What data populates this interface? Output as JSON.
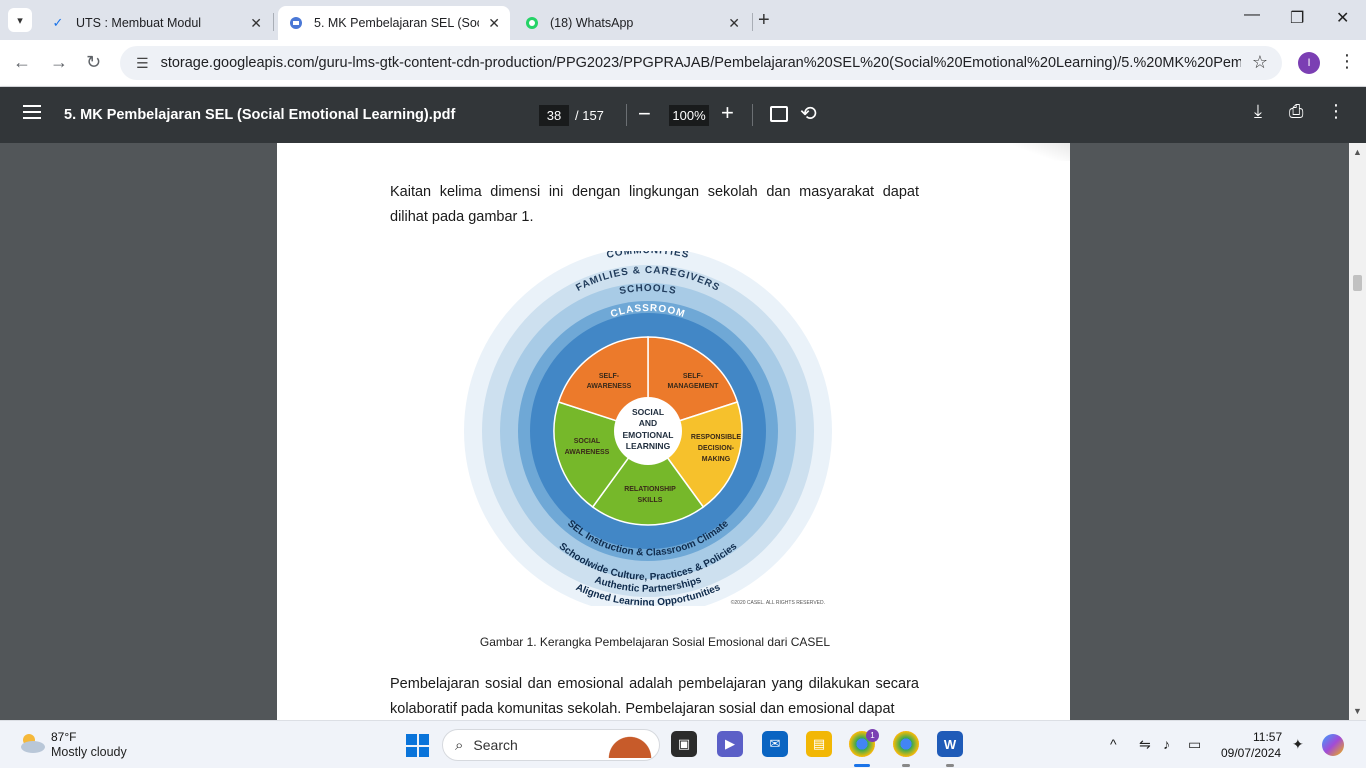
{
  "browser": {
    "tabs": [
      {
        "title": "UTS : Membuat Modul",
        "active": false
      },
      {
        "title": "5. MK Pembelajaran SEL (Social",
        "active": true
      },
      {
        "title": "(18) WhatsApp",
        "active": false
      }
    ],
    "url": "storage.googleapis.com/guru-lms-gtk-content-cdn-production/PPG2023/PPGPRAJAB/Pembelajaran%20SEL%20(Social%20Emotional%20Learning)/5.%20MK%20Pembelajara...",
    "profile_initial": "I"
  },
  "pdf": {
    "title": "5. MK Pembelajaran SEL (Social Emotional Learning).pdf",
    "current_page": "38",
    "total_pages": "/ 157",
    "zoom": "100%"
  },
  "document": {
    "para1": "Kaitan kelima dimensi ini dengan lingkungan sekolah dan masyarakat dapat dilihat pada gambar 1.",
    "caption": "Gambar 1. Kerangka Pembelajaran Sosial Emosional dari CASEL",
    "para2": "Pembelajaran sosial dan emosional adalah pembelajaran yang dilakukan secara kolaboratif pada komunitas sekolah. Pembelajaran sosial dan emosional dapat"
  },
  "figure": {
    "ring_communities": "COMMUNITIES",
    "ring_families": "FAMILIES & CAREGIVERS",
    "ring_schools": "SCHOOLS",
    "ring_classroom": "CLASSROOM",
    "center_line1": "SOCIAL",
    "center_line2": "AND",
    "center_line3": "EMOTIONAL",
    "center_line4": "LEARNING",
    "seg_self_awareness_1": "SELF-",
    "seg_self_awareness_2": "AWARENESS",
    "seg_self_management_1": "SELF-",
    "seg_self_management_2": "MANAGEMENT",
    "seg_responsible_1": "RESPONSIBLE",
    "seg_responsible_2": "DECISION-",
    "seg_responsible_3": "MAKING",
    "seg_relationship_1": "RELATIONSHIP",
    "seg_relationship_2": "SKILLS",
    "seg_social_1": "SOCIAL",
    "seg_social_2": "AWARENESS",
    "arc_instruction": "SEL Instruction & Classroom Climate",
    "arc_schoolwide": "Schoolwide Culture, Practices & Policies",
    "arc_authentic": "Authentic Partnerships",
    "arc_aligned": "Aligned Learning Opportunities",
    "copyright": "©2020 CASEL. ALL RIGHTS RESERVED."
  },
  "taskbar": {
    "temp": "87°F",
    "weather": "Mostly cloudy",
    "search_placeholder": "Search",
    "time": "11:57",
    "date": "09/07/2024"
  }
}
